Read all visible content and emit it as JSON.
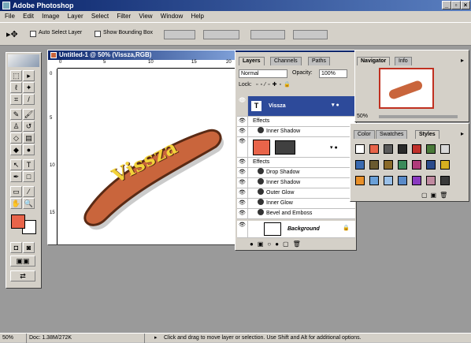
{
  "app": {
    "title": "Adobe Photoshop"
  },
  "menu": [
    "File",
    "Edit",
    "Image",
    "Layer",
    "Select",
    "Filter",
    "View",
    "Window",
    "Help"
  ],
  "options": {
    "auto_select": "Auto Select Layer",
    "bounding_box": "Show Bounding Box"
  },
  "document": {
    "title": "Untitled-1 @ 50% (Vissza,RGB)",
    "artwork_text": "Vissza",
    "ruler_h": [
      "0",
      "5",
      "10",
      "15",
      "20"
    ],
    "ruler_v": [
      "0",
      "5",
      "10",
      "15"
    ]
  },
  "layers_panel": {
    "tabs": [
      "Layers",
      "Channels",
      "Paths"
    ],
    "mode": "Normal",
    "opacity_label": "Opacity:",
    "opacity_value": "100%",
    "lock_label": "Lock:",
    "layer1": {
      "name": "Vissza",
      "effects_label": "Effects",
      "effects": [
        "Inner Shadow"
      ]
    },
    "layer2": {
      "effects_label": "Effects",
      "effects": [
        "Drop Shadow",
        "Inner Shadow",
        "Outer Glow",
        "Inner Glow",
        "Bevel and Emboss"
      ]
    },
    "background": "Background"
  },
  "navigator": {
    "tabs": [
      "Navigator",
      "Info"
    ],
    "zoom": "50%"
  },
  "styles_panel": {
    "tabs": [
      "Color",
      "Swatches",
      "Styles"
    ]
  },
  "status": {
    "zoom": "50%",
    "doc": "Doc: 1.38M/272K",
    "hint": "Click and drag to move layer or selection.  Use Shift and Alt for additional options."
  },
  "colors": {
    "foreground": "#e8644a",
    "background": "#ffffff",
    "artwork": "#c9653c",
    "title_bar": "#0a246a"
  }
}
